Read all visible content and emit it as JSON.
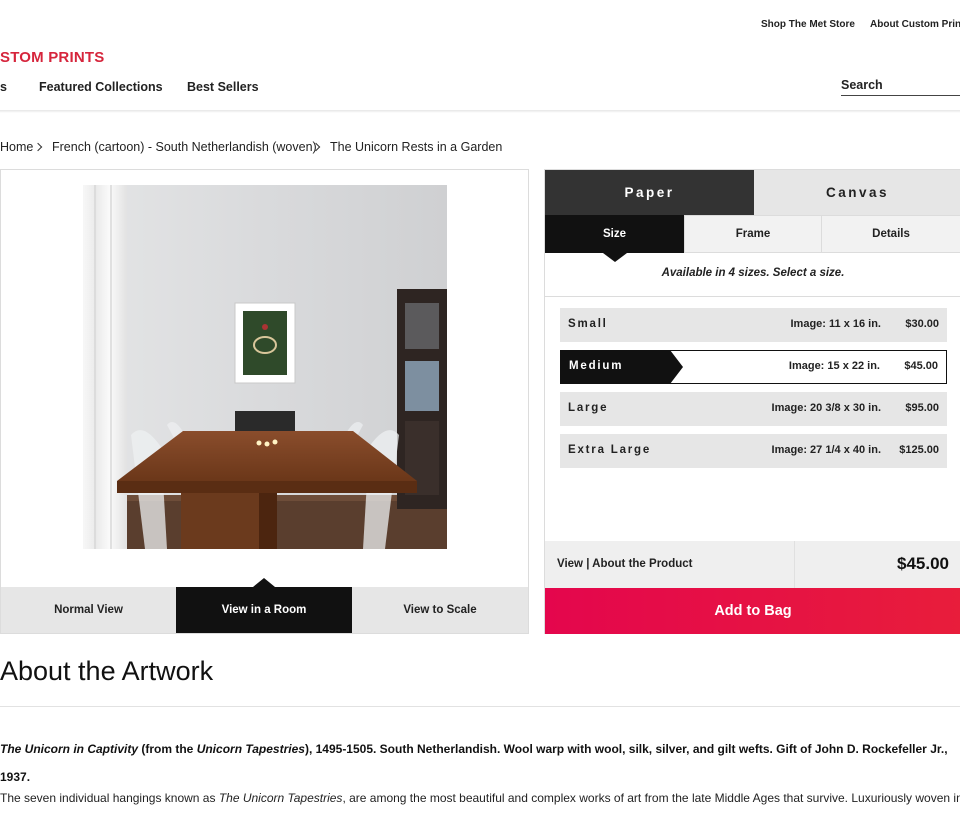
{
  "top_links": {
    "shop": "Shop The Met Store",
    "about_custom": "About Custom Prints"
  },
  "brand": "STOM PRINTS",
  "nav": {
    "partial_item": "s",
    "featured": "Featured Collections",
    "best_sellers": "Best Sellers"
  },
  "search": {
    "placeholder": "Search"
  },
  "breadcrumb": [
    "Home",
    "French (cartoon) - South Netherlandish (woven)",
    "The Unicorn Rests in a Garden"
  ],
  "view_tabs": {
    "normal": "Normal View",
    "room": "View in a Room",
    "scale": "View to Scale",
    "active": "View in a Room"
  },
  "medium_tabs": {
    "paper": "Paper",
    "canvas": "Canvas",
    "active": "Paper"
  },
  "option_tabs": {
    "size": "Size",
    "frame": "Frame",
    "details": "Details",
    "active": "Size"
  },
  "availability": "Available in 4 sizes. Select a size.",
  "sizes": [
    {
      "name": "Small",
      "dimensions": "Image: 11 x 16 in.",
      "price": "$30.00",
      "selected": false
    },
    {
      "name": "Medium",
      "dimensions": "Image: 15 x 22 in.",
      "price": "$45.00",
      "selected": true
    },
    {
      "name": "Large",
      "dimensions": "Image: 20 3/8 x 30 in.",
      "price": "$95.00",
      "selected": false
    },
    {
      "name": "Extra Large",
      "dimensions": "Image: 27 1/4 x 40 in.",
      "price": "$125.00",
      "selected": false
    }
  ],
  "product_link": "View | About the Product",
  "total_price": "$45.00",
  "add_to_bag": "Add to Bag",
  "about": {
    "heading": "About the Artwork",
    "credit_title": "The Unicorn in Captivity",
    "credit_from": " (from the ",
    "credit_series": "Unicorn Tapestries",
    "credit_rest": "), 1495-1505. South Netherlandish. Wool warp with wool, silk, silver, and gilt wefts. Gift of John D. Rockefeller Jr., 1937.",
    "desc_start": "The seven individual hangings known as ",
    "desc_title": "The Unicorn Tapestries",
    "desc_rest": ", are among the most beautiful and complex works of art from the late Middle Ages that survive. Luxuriously woven in"
  },
  "colors": {
    "brand_red": "#d6253c",
    "add_to_bag": "#e4064d",
    "dark_tab": "#333333",
    "selected": "#111111",
    "inactive_tab": "#e6e6e6"
  }
}
